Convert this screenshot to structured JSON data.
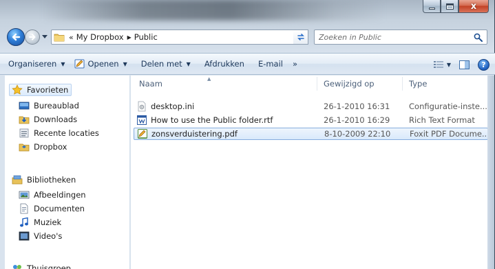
{
  "window": {
    "caption_buttons": {
      "minimize": "minimize",
      "maximize": "maximize",
      "close": "x"
    }
  },
  "address": {
    "overflow": "«",
    "crumbs": [
      "My Dropbox",
      "Public"
    ]
  },
  "search": {
    "placeholder": "Zoeken in Public"
  },
  "toolbar": {
    "organize": "Organiseren",
    "open": "Openen",
    "share": "Delen met",
    "print": "Afdrukken",
    "email": "E-mail",
    "more": "»",
    "help": "?"
  },
  "navigation": {
    "favorites": {
      "label": "Favorieten",
      "items": [
        "Bureaublad",
        "Downloads",
        "Recente locaties",
        "Dropbox"
      ]
    },
    "libraries": {
      "label": "Bibliotheken",
      "items": [
        "Afbeeldingen",
        "Documenten",
        "Muziek",
        "Video's"
      ]
    },
    "homegroup": {
      "label": "Thuisgroep"
    }
  },
  "columns": {
    "name": "Naam",
    "modified": "Gewijzigd op",
    "type": "Type"
  },
  "files": [
    {
      "name": "desktop.ini",
      "modified": "26-1-2010 16:31",
      "type": "Configuratie-inste...",
      "icon": "ini-file-icon"
    },
    {
      "name": "How to use the Public folder.rtf",
      "modified": "26-1-2010 16:29",
      "type": "Rich Text Format",
      "icon": "rtf-file-icon"
    },
    {
      "name": "zonsverduistering.pdf",
      "modified": "8-10-2009 22:10",
      "type": "Foxit PDF Docume...",
      "icon": "pdf-file-icon",
      "selected": true
    }
  ],
  "colors": {
    "accent": "#1e395b",
    "selection": "#d9e9fb",
    "selection_border": "#84acdd",
    "column_header": "#4c607a"
  }
}
